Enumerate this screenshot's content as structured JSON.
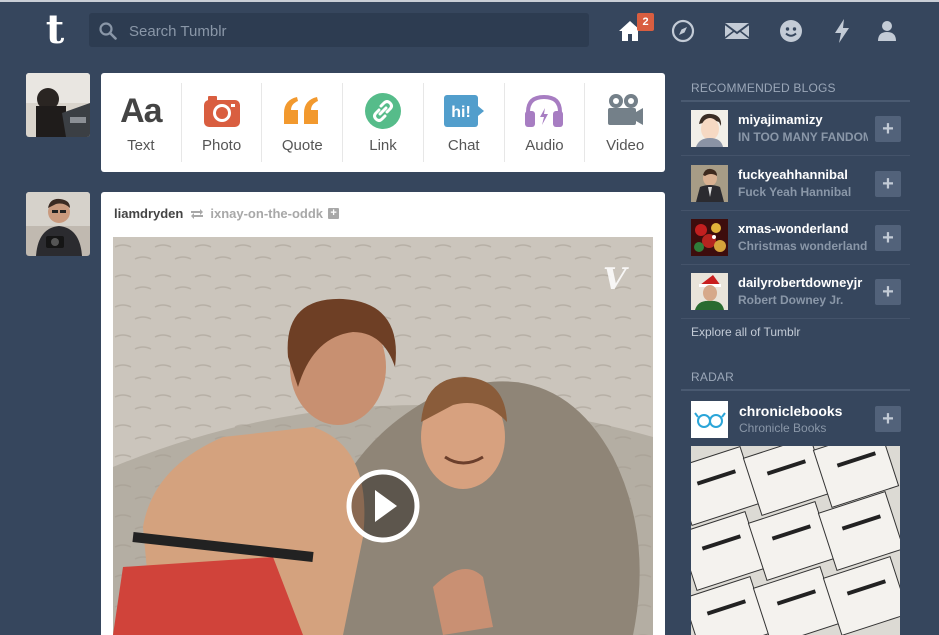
{
  "header": {
    "logo": "t",
    "search_placeholder": "Search Tumblr",
    "home_badge": "2",
    "nav_icons": [
      "home-icon",
      "explore-icon",
      "inbox-icon",
      "messaging-icon",
      "activity-icon",
      "account-icon"
    ]
  },
  "composer": {
    "types": [
      {
        "label": "Text",
        "icon": "text-icon",
        "color": "#444444"
      },
      {
        "label": "Photo",
        "icon": "camera-icon",
        "color": "#d95e40"
      },
      {
        "label": "Quote",
        "icon": "quote-icon",
        "color": "#f2992e"
      },
      {
        "label": "Link",
        "icon": "link-icon",
        "color": "#56bc8a"
      },
      {
        "label": "Chat",
        "icon": "chat-icon",
        "color": "#529ecc"
      },
      {
        "label": "Audio",
        "icon": "headphones-icon",
        "color": "#a77dc2"
      },
      {
        "label": "Video",
        "icon": "video-camera-icon",
        "color": "#748089"
      }
    ]
  },
  "post": {
    "author": "liamdryden",
    "reblogged_from": "ixnay-on-the-oddk",
    "media_type": "vine video"
  },
  "sidebar": {
    "recommended_heading": "RECOMMENDED BLOGS",
    "blogs": [
      {
        "name": "miyajimamizy",
        "title": "IN TOO MANY FANDOMS"
      },
      {
        "name": "fuckyeahhannibal",
        "title": "Fuck Yeah Hannibal"
      },
      {
        "name": "xmas-wonderland",
        "title": "Christmas wonderland"
      },
      {
        "name": "dailyrobertdowneyjr",
        "title": "Robert Downey Jr."
      }
    ],
    "explore_link": "Explore all of Tumblr",
    "radar_heading": "RADAR",
    "radar_blog": {
      "name": "chroniclebooks",
      "title": "Chronicle Books"
    }
  },
  "colors": {
    "background": "#36465d",
    "accent": "#d95e40"
  }
}
